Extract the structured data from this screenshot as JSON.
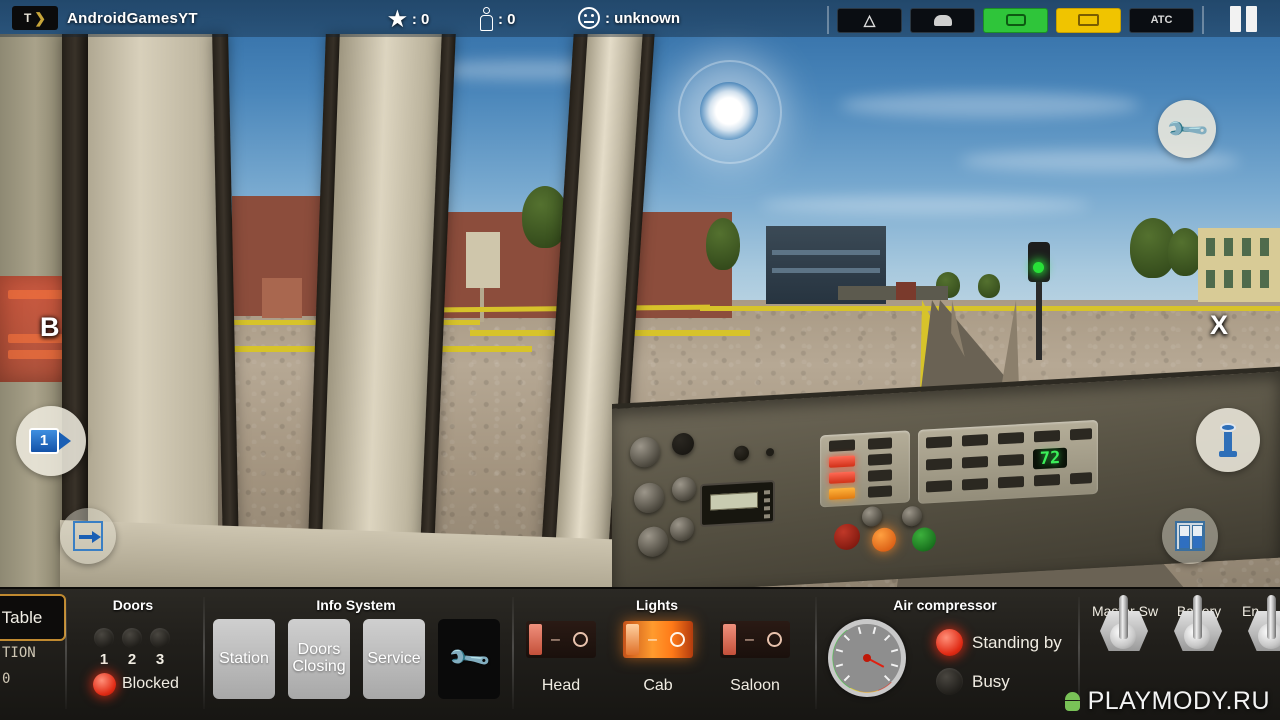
{
  "topbar": {
    "brand_logo_letter": "T",
    "brand_logo_chevron": "❯",
    "brand_name": "AndroidGamesYT",
    "stats": [
      {
        "icon": "star-icon",
        "glyph": "★",
        "value": ": 0"
      },
      {
        "icon": "passenger-icon",
        "glyph": "",
        "value": ": 0"
      },
      {
        "icon": "mood-icon",
        "glyph": "",
        "value": ": unknown"
      }
    ],
    "buttons": [
      {
        "name": "warning-button",
        "label": "",
        "icon": "warning-triangle-icon",
        "state": "off"
      },
      {
        "name": "sander-button",
        "label": "",
        "icon": "sander-icon",
        "state": "off"
      },
      {
        "name": "pantograph-button",
        "label": "",
        "icon": "pantograph-icon",
        "state": "on-green"
      },
      {
        "name": "battery-button",
        "label": "",
        "icon": "battery-icon",
        "state": "on-yellow"
      },
      {
        "name": "atc-button",
        "label": "ATC",
        "icon": "",
        "state": "off"
      }
    ],
    "pause_label": "II"
  },
  "overlay": {
    "brake_marker": "B",
    "throttle_marker": "X",
    "camera_button_label": "1",
    "camera_icon": "video-camera-icon",
    "exit_icon": "exit-door-icon",
    "wrench_icon": "wrench-icon",
    "horn_icon": "horn-lever-icon",
    "doors_icon": "train-doors-icon"
  },
  "console": {
    "speed_display": "72"
  },
  "bottom": {
    "table_button": "Table",
    "lcd_line1": "TION",
    "lcd_line2": "0",
    "doors": {
      "title": "Doors",
      "lamps": [
        {
          "label": "1",
          "lit": false
        },
        {
          "label": "2",
          "lit": false
        },
        {
          "label": "3",
          "lit": false
        }
      ],
      "status_label": "Blocked",
      "status_lit": true
    },
    "info_system": {
      "title": "Info System",
      "buttons": [
        {
          "name": "info-station-button",
          "label": "Station"
        },
        {
          "name": "info-doors-closing-button",
          "label": "Doors Closing"
        },
        {
          "name": "info-service-button",
          "label": "Service"
        }
      ],
      "wrench_button_icon": "wrench-icon"
    },
    "lights": {
      "title": "Lights",
      "switches": [
        {
          "name": "light-head-switch",
          "label": "Head",
          "on": false
        },
        {
          "name": "light-cab-switch",
          "label": "Cab",
          "on": true
        },
        {
          "name": "light-saloon-switch",
          "label": "Saloon",
          "on": false
        }
      ]
    },
    "air_compressor": {
      "title": "Air compressor",
      "gauge_needle_deg": 118,
      "states": [
        {
          "name": "compressor-standing-by",
          "label": "Standing by",
          "lit": true
        },
        {
          "name": "compressor-busy",
          "label": "Busy",
          "lit": false
        }
      ]
    },
    "switches": [
      {
        "name": "master-switch",
        "label": "Master Sw"
      },
      {
        "name": "battery-switch",
        "label": "Battery"
      },
      {
        "name": "engine-switch",
        "label": "En"
      }
    ]
  },
  "watermark": {
    "text": "PLAYMODY.RU",
    "icon": "android-robot-icon"
  },
  "colors": {
    "accent_green": "#2fc53a",
    "accent_yellow": "#f0c400",
    "alert_red": "#e02a14",
    "panel_dark": "#211f1b"
  }
}
